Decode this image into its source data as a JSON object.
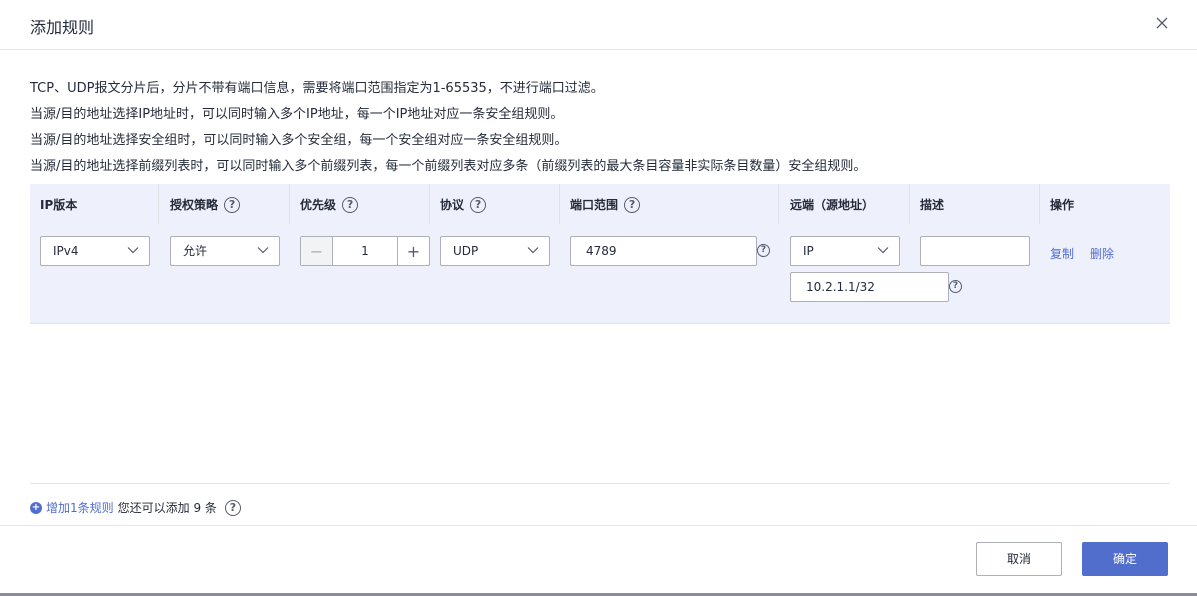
{
  "dialog": {
    "title": "添加规则"
  },
  "notes": [
    "TCP、UDP报文分片后，分片不带有端口信息，需要将端口范围指定为1-65535，不进行端口过滤。",
    "当源/目的地址选择IP地址时，可以同时输入多个IP地址，每一个IP地址对应一条安全组规则。",
    "当源/目的地址选择安全组时，可以同时输入多个安全组，每一个安全组对应一条安全组规则。",
    "当源/目的地址选择前缀列表时，可以同时输入多个前缀列表，每一个前缀列表对应多条（前缀列表的最大条目容量非实际条目数量）安全组规则。"
  ],
  "table": {
    "headers": {
      "ip_version": "IP版本",
      "policy": "授权策略",
      "priority": "优先级",
      "protocol": "协议",
      "port_range": "端口范围",
      "remote": "远端（源地址）",
      "description": "描述",
      "actions": "操作"
    },
    "row": {
      "ip_version": "IPv4",
      "policy": "允许",
      "priority": "1",
      "protocol": "UDP",
      "port_range": "4789",
      "remote_type": "IP",
      "remote_address": "10.2.1.1/32",
      "description": "",
      "copy": "复制",
      "delete": "删除"
    }
  },
  "add_rule": {
    "link": "增加1条规则",
    "text": "您还可以添加 9 条"
  },
  "footer": {
    "cancel": "取消",
    "confirm": "确定"
  },
  "colors": {
    "primary": "#526ecc",
    "table_bg": "#eef0fc",
    "border": "#adb0b8"
  },
  "icons": {
    "help": "?",
    "minus": "−",
    "plus": "+",
    "add": "+"
  }
}
